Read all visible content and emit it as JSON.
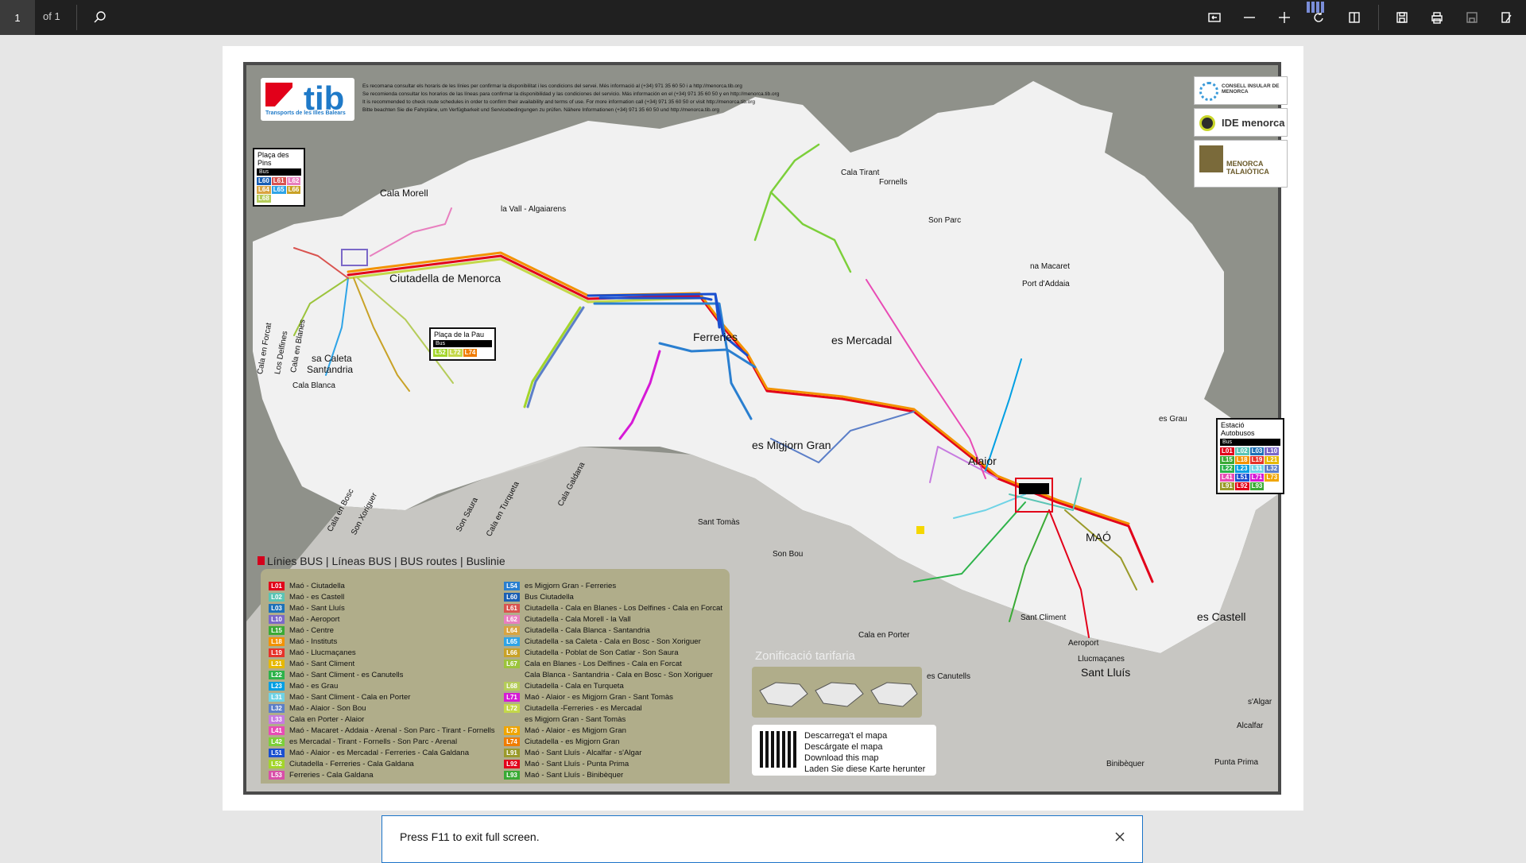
{
  "toolbar": {
    "page_number": "1",
    "page_of": "of 1",
    "icons": [
      "search-icon",
      "fit-page-icon",
      "zoom-out-icon",
      "zoom-in-icon",
      "rotate-icon",
      "two-page-icon",
      "save-icon",
      "print-icon",
      "save-disabled-icon",
      "edit-icon"
    ]
  },
  "map": {
    "logo_text": "tib",
    "logo_sub": "Transports de les Illes Balears",
    "disclaimer": [
      "Es recomana consultar els horaris de les línies per confirmar la disponibilitat i les condicions del servei. Més informació al (+34) 971 35 60 50 i a http://menorca.tib.org",
      "Se recomienda consultar los horarios de las líneas para confirmar la disponibilidad y las condiciones del servicio. Más información en el (+34) 971 35 60 50 y en http://menorca.tib.org",
      "It is recommended to check route schedules in order to confirm their availability and terms of use. For more information call (+34) 971 35 60 50 or visit http://menorca.tib.org",
      "Bitte beachten Sie die Fahrpläne, um Verfügbarkeit und Servicebedingungen zu prüfen. Nähere Informationen (+34) 971 35 60 50 und http://menorca.tib.org"
    ],
    "partners": [
      "CONSELL INSULAR DE MENORCA",
      "IDE menorca",
      "MENORCA TALAIÒTICA"
    ],
    "stop_boxes": {
      "pins": {
        "title": "Plaça des Pins",
        "bus": "Bus",
        "lines": [
          "L60",
          "L61",
          "L62",
          "L64",
          "L65",
          "L66",
          "L68"
        ]
      },
      "pau": {
        "title": "Plaça de la Pau",
        "bus": "Bus",
        "lines": [
          "L52",
          "L72",
          "L74"
        ]
      },
      "estacio": {
        "title": "Estació Autobusos",
        "bus": "Bus",
        "lines": [
          "L01",
          "L02",
          "L03",
          "L10",
          "L15",
          "L18",
          "L19",
          "L21",
          "L22",
          "L23",
          "L31",
          "L32",
          "L41",
          "L51",
          "L71",
          "L73",
          "L91",
          "L92",
          "L93"
        ]
      }
    },
    "places": {
      "ciutadella": "Ciutadella de Menorca",
      "ferreries": "Ferreries",
      "es_mercadal": "es Mercadal",
      "migjorn": "es Migjorn Gran",
      "alaior": "Alaior",
      "mao": "MAÓ",
      "es_castell": "es Castell",
      "sant_lluis": "Sant Lluís",
      "cala_morell": "Cala Morell",
      "vall": "la Vall - Algaiarens",
      "cala_tirant": "Cala Tirant",
      "fornells": "Fornells",
      "son_parc": "Son Parc",
      "na_macaret": "na Macaret",
      "port_addaia": "Port d'Addaia",
      "es_grau": "es Grau",
      "sa_caleta": "sa Caleta",
      "santandria": "Santandria",
      "cala_blanca": "Cala Blanca",
      "sant_tomas": "Sant Tomàs",
      "son_bou": "Son Bou",
      "cala_en_porter": "Cala en Porter",
      "sant_climent": "Sant Climent",
      "aeroport": "Aeroport",
      "llucmacanes": "Llucmaçanes",
      "es_canutells": "es Canutells",
      "biniebequer": "Binibèquer",
      "punta_prima": "Punta Prima",
      "alcalfar": "Alcalfar",
      "s_algar": "s'Algar",
      "cala_en_turqueta": "Cala en Turqueta",
      "son_saura": "Son Saura",
      "cala_galdana": "Cala Galdana",
      "son_xoriguer": "Son Xoriguer",
      "cala_en_bosc": "Cala en Bosc",
      "cala_en_forcat": "Cala en Forcat",
      "los_delfines": "Los Delfines",
      "cala_en_blanes": "Cala en Blanes"
    },
    "legend_title": "Línies BUS | Líneas BUS | BUS routes | Buslinie",
    "legend_left": [
      {
        "code": "L01",
        "color": "#e2001a",
        "text": "Maó - Ciutadella"
      },
      {
        "code": "L02",
        "color": "#5bc5b5",
        "text": "Maó - es Castell"
      },
      {
        "code": "L03",
        "color": "#1d71b8",
        "text": "Maó - Sant Lluís"
      },
      {
        "code": "L10",
        "color": "#7b68c8",
        "text": "Maó - Aeroport"
      },
      {
        "code": "L15",
        "color": "#3aaa35",
        "text": "Maó - Centre"
      },
      {
        "code": "L18",
        "color": "#f39200",
        "text": "Maó - Instituts"
      },
      {
        "code": "L19",
        "color": "#e6332a",
        "text": "Maó - Llucmaçanes"
      },
      {
        "code": "L21",
        "color": "#e6b800",
        "text": "Maó - Sant Climent"
      },
      {
        "code": "L22",
        "color": "#2db34a",
        "text": "Maó - Sant Climent - es Canutells"
      },
      {
        "code": "L23",
        "color": "#009fe3",
        "text": "Maó - es Grau"
      },
      {
        "code": "L31",
        "color": "#6fd3e6",
        "text": "Maó - Sant Climent - Cala en Porter"
      },
      {
        "code": "L32",
        "color": "#5c7fc8",
        "text": "Maó - Alaior - Son Bou"
      },
      {
        "code": "L33",
        "color": "#c77be0",
        "text": "Cala en Porter - Alaior"
      },
      {
        "code": "L41",
        "color": "#e84bb5",
        "text": "Maó - Macaret - Addaia - Arenal - Son Parc - Tirant - Fornells"
      },
      {
        "code": "L42",
        "color": "#7ccf3a",
        "text": "es Mercadal - Tirant - Fornells - Son Parc - Arenal"
      },
      {
        "code": "L51",
        "color": "#1a4fd0",
        "text": "Maó - Alaior - es Mercadal - Ferreries - Cala Galdana"
      },
      {
        "code": "L52",
        "color": "#a3d52b",
        "text": "Ciutadella - Ferreries - Cala Galdana"
      },
      {
        "code": "L53",
        "color": "#d94fa8",
        "text": "Ferreries - Cala Galdana"
      }
    ],
    "legend_right": [
      {
        "code": "L54",
        "color": "#2a7fd0",
        "text": "es Migjorn Gran - Ferreries"
      },
      {
        "code": "L60",
        "color": "#1a5fb4",
        "text": "Bus Ciutadella"
      },
      {
        "code": "L61",
        "color": "#d9534f",
        "text": "Ciutadella - Cala en Blanes - Los Delfines - Cala en Forcat"
      },
      {
        "code": "L62",
        "color": "#e87fbf",
        "text": "Ciutadella - Cala Morell - la Vall"
      },
      {
        "code": "L64",
        "color": "#d9a441",
        "text": "Ciutadella - Cala Blanca - Santandria"
      },
      {
        "code": "L65",
        "color": "#2fa4e7",
        "text": "Ciutadella - sa Caleta - Cala en Bosc - Son Xoriguer"
      },
      {
        "code": "L66",
        "color": "#c9a227",
        "text": "Ciutadella - Poblat de Son Catlar - Son Saura"
      },
      {
        "code": "L67",
        "color": "#9cc43c",
        "text": "Cala en Blanes - Los Delfines - Cala en Forcat"
      },
      {
        "code": "",
        "color": "transparent",
        "text": "Cala Blanca - Santandria - Cala en Bosc - Son Xoriguer"
      },
      {
        "code": "L68",
        "color": "#b5cc5a",
        "text": "Ciutadella - Cala en Turqueta"
      },
      {
        "code": "L71",
        "color": "#d61ad6",
        "text": "Maó - Alaior - es Migjorn Gran - Sant Tomàs"
      },
      {
        "code": "L72",
        "color": "#c4d84a",
        "text": "Ciutadella -Ferreries - es Mercadal"
      },
      {
        "code": "",
        "color": "transparent",
        "text": "es Migjorn Gran - Sant Tomàs"
      },
      {
        "code": "L73",
        "color": "#f0a500",
        "text": "Maó - Alaior - es Migjorn Gran"
      },
      {
        "code": "L74",
        "color": "#f07c00",
        "text": "Ciutadella - es Migjorn Gran"
      },
      {
        "code": "L91",
        "color": "#9a9a2a",
        "text": "Maó - Sant Lluís - Alcalfar - s'Algar"
      },
      {
        "code": "L92",
        "color": "#e2001a",
        "text": "Maó - Sant Lluís - Punta Prima"
      },
      {
        "code": "L93",
        "color": "#3aaa35",
        "text": "Maó - Sant Lluís - Binibèquer"
      }
    ],
    "zonificacio_title": "Zonificació tarifaria",
    "download": [
      "Descarrega't el mapa",
      "Descárgate el mapa",
      "Download this map",
      "Laden Sie diese Karte herunter"
    ]
  },
  "toast": {
    "message": "Press F11 to exit full screen."
  }
}
